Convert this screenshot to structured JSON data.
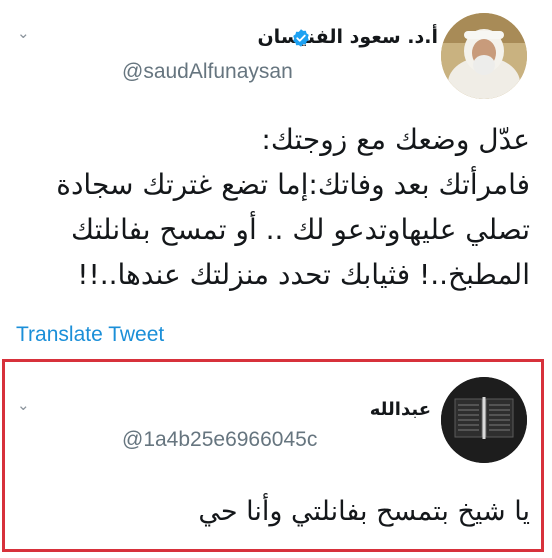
{
  "tweet": {
    "author_name": "أ.د. سعود الفنيسان",
    "handle": "@saudAlfunaysan",
    "verified": true,
    "text_lines": [
      "عدّل وضعك مع زوجتك:",
      "فامرأتك بعد وفاتك:إما تضع غترتك سجادة",
      "تصلي عليهاوتدعو لك .. أو تمسح بفانلتك",
      "المطبخ..! فثيابك تحدد منزلتك عندها..!!"
    ],
    "translate_label": "Translate Tweet"
  },
  "reply": {
    "author_name": "عبدالله",
    "handle": "@1a4b25e6966045c",
    "text": "يا شيخ بتمسح بفانلتي وأنا حي"
  },
  "icons": {
    "menu_chevron": "chevron-down-icon",
    "verified_badge": "verified-badge-icon"
  },
  "colors": {
    "link": "#1b8fd8",
    "verified": "#1da1f2",
    "highlight_border": "#d7313b",
    "secondary_text": "#66757f"
  }
}
